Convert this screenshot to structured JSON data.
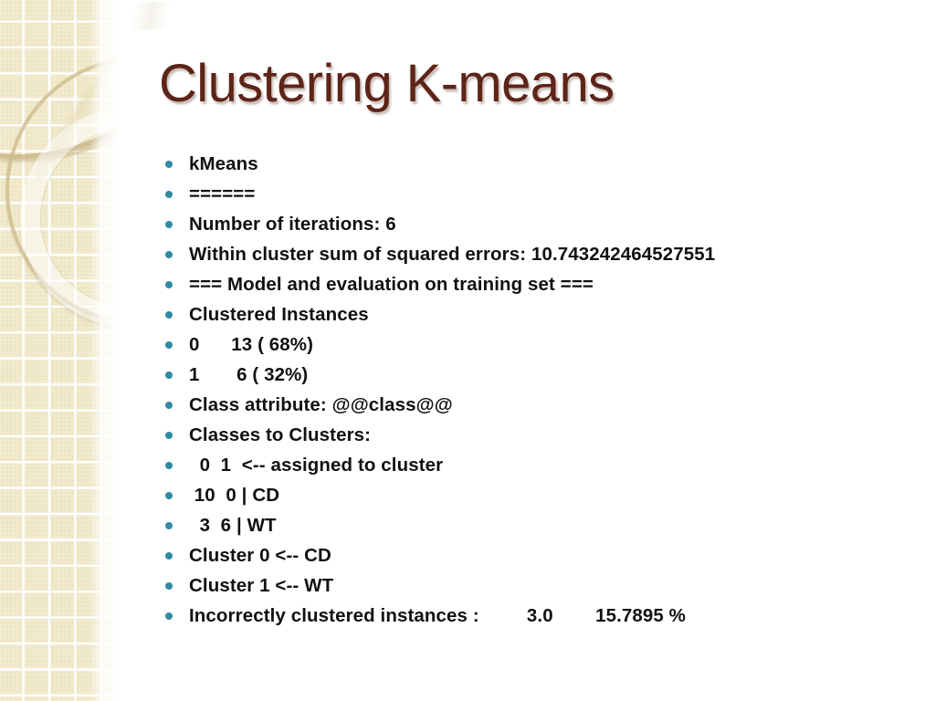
{
  "slide": {
    "title": "Clustering K-means",
    "title_color": "#5e2418",
    "bullet_color": "#2f8ba3",
    "text_color": "#111111",
    "band_color": "#eee5c3"
  },
  "body": {
    "bullets": [
      {
        "text": "kMeans"
      },
      {
        "text": "======"
      },
      {
        "text": "Number of iterations: 6"
      },
      {
        "text": "Within cluster sum of squared errors: 10.743242464527551"
      },
      {
        "text": "=== Model and evaluation on training set ==="
      },
      {
        "text": "Clustered Instances"
      },
      {
        "text": "0      13 ( 68%)"
      },
      {
        "text": "1       6 ( 32%)"
      },
      {
        "text": "Class attribute: @@class@@"
      },
      {
        "text": "Classes to Clusters:"
      },
      {
        "text": "  0  1  <-- assigned to cluster"
      },
      {
        "text": " 10  0 | CD"
      },
      {
        "text": "  3  6 | WT"
      },
      {
        "text": "Cluster 0 <-- CD"
      },
      {
        "text": "Cluster 1 <-- WT"
      },
      {
        "text": "Incorrectly clustered instances :         3.0        15.7895 %"
      }
    ]
  }
}
